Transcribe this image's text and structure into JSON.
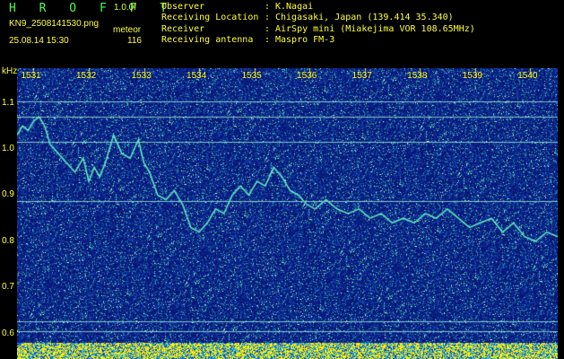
{
  "header": {
    "title": "H R O F F T",
    "version": "1.0.0f",
    "filename": "KN9_2508141530.png",
    "datetime": "25.08.14 15:30",
    "meteor_label": "meteor",
    "meteor_count": "116"
  },
  "info": [
    {
      "key": "Observer",
      "value": "K.Nagai"
    },
    {
      "key": "Receiving Location",
      "value": "Chigasaki, Japan (139.414 35.340)"
    },
    {
      "key": "Receiver",
      "value": "AirSpy mini (Miakejima VOR 108.65MHz)"
    },
    {
      "key": "Receiving antenna",
      "value": "Maspro FM-3"
    }
  ],
  "colors": {
    "background": "#0a1a7a",
    "text": "#ffff3a",
    "title": "#4cff4c",
    "trace": "#5fe8c0",
    "bottom_band": "#ffff00"
  },
  "chart_data": {
    "type": "heatmap",
    "ylabel": "kHz",
    "y_ticks": [
      "1.1",
      "1.0",
      "0.9",
      "0.8",
      "0.7",
      "0.6"
    ],
    "x_ticks": [
      "1531",
      "1532",
      "1533",
      "1534",
      "1535",
      "1536",
      "1537",
      "1538",
      "1539",
      "1540"
    ],
    "ylim": [
      0.58,
      1.175
    ],
    "xlim": [
      1530.7,
      1540.5
    ],
    "horizontal_lines_khz": [
      1.103,
      1.07,
      1.015,
      0.887,
      0.627,
      0.605
    ],
    "trace": {
      "x": [
        1530.7,
        1530.8,
        1530.9,
        1531.0,
        1531.1,
        1531.2,
        1531.3,
        1531.45,
        1531.6,
        1531.75,
        1531.9,
        1532.0,
        1532.1,
        1532.2,
        1532.3,
        1532.45,
        1532.6,
        1532.75,
        1532.9,
        1533.0,
        1533.1,
        1533.25,
        1533.4,
        1533.55,
        1533.7,
        1533.85,
        1534.0,
        1534.15,
        1534.3,
        1534.45,
        1534.6,
        1534.75,
        1534.9,
        1535.05,
        1535.2,
        1535.35,
        1535.5,
        1535.65,
        1535.8,
        1535.95,
        1536.1,
        1536.3,
        1536.5,
        1536.7,
        1536.9,
        1537.1,
        1537.3,
        1537.5,
        1537.7,
        1537.9,
        1538.1,
        1538.3,
        1538.5,
        1538.7,
        1538.9,
        1539.1,
        1539.3,
        1539.5,
        1539.7,
        1539.9,
        1540.1,
        1540.3,
        1540.5
      ],
      "y": [
        1.03,
        1.05,
        1.04,
        1.06,
        1.07,
        1.05,
        1.01,
        0.99,
        0.97,
        0.95,
        0.98,
        0.93,
        0.96,
        0.94,
        0.97,
        1.03,
        0.99,
        0.98,
        1.02,
        0.97,
        0.95,
        0.9,
        0.89,
        0.91,
        0.88,
        0.83,
        0.82,
        0.84,
        0.87,
        0.86,
        0.9,
        0.92,
        0.9,
        0.93,
        0.92,
        0.96,
        0.94,
        0.91,
        0.9,
        0.88,
        0.87,
        0.89,
        0.87,
        0.86,
        0.87,
        0.85,
        0.86,
        0.84,
        0.85,
        0.84,
        0.86,
        0.85,
        0.87,
        0.85,
        0.83,
        0.84,
        0.85,
        0.82,
        0.84,
        0.81,
        0.8,
        0.82,
        0.81
      ]
    }
  }
}
